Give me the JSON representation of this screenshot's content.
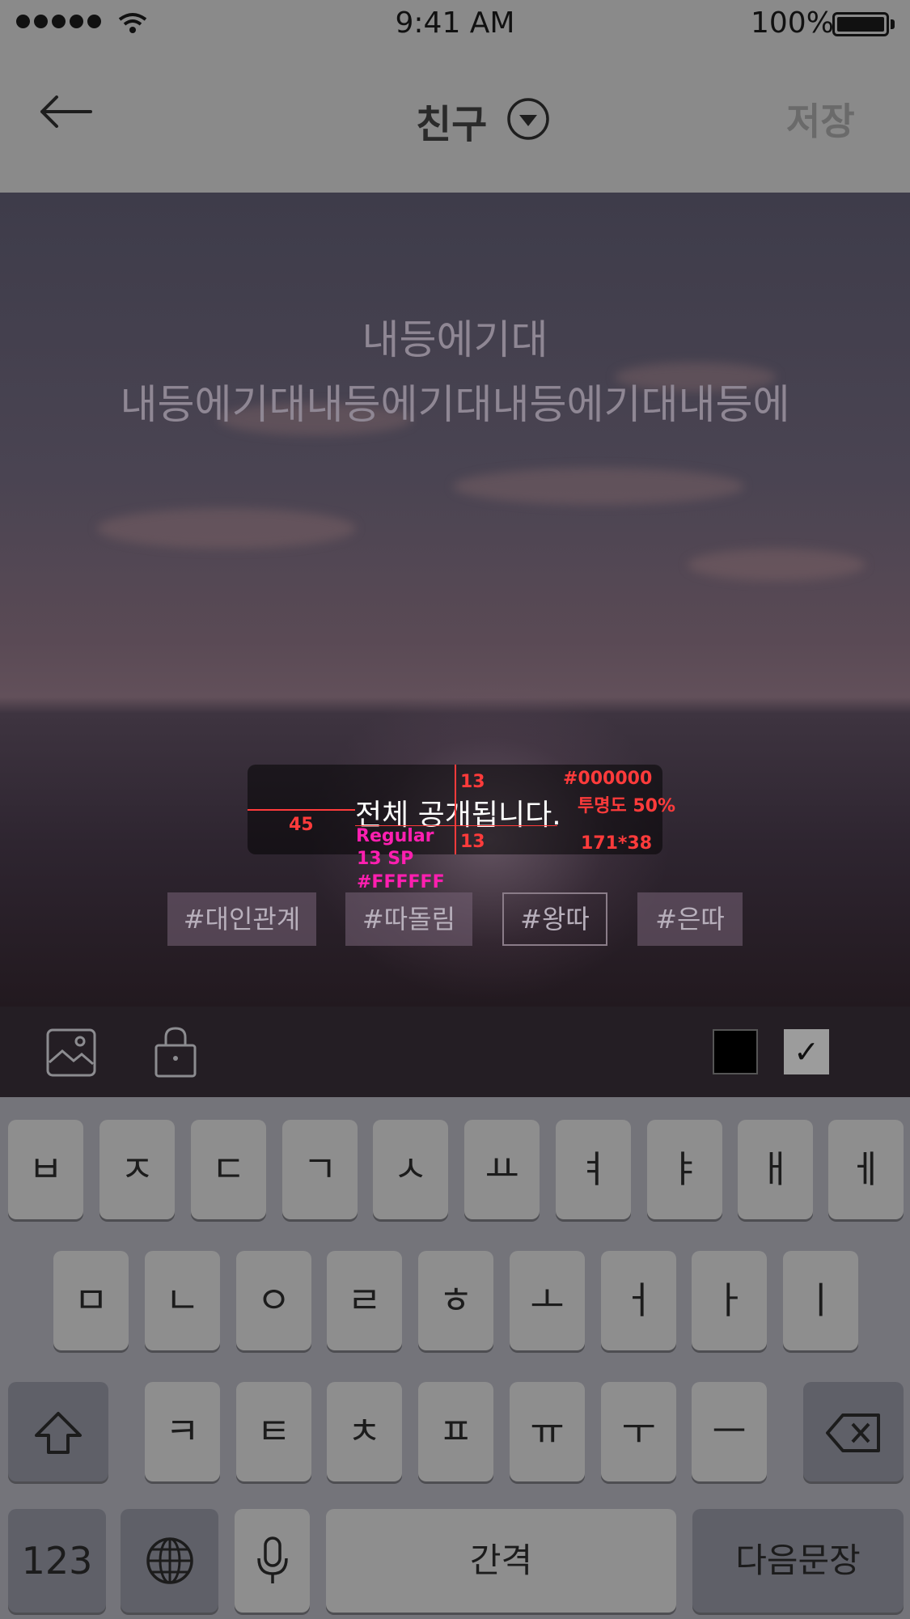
{
  "status_bar": {
    "time": "9:41 AM",
    "battery": "100%"
  },
  "header": {
    "title": "친구",
    "save_label": "저장"
  },
  "caption": {
    "line1": "내등에기대",
    "line2": "내등에기대내등에기대내등에기대내등에"
  },
  "toast": {
    "text": "전체 공개됩니다.",
    "annotations": {
      "padding_top": "13",
      "padding_bottom": "13",
      "padding_left": "45",
      "bg_color": "#000000",
      "opacity": "투명도 50%",
      "size": "171*38",
      "font_weight": "Regular",
      "font_size": "13 SP",
      "font_color": "#FFFFFF"
    }
  },
  "tags": [
    "#대인관계",
    "#따돌림",
    "#왕따",
    "#은따"
  ],
  "selected_tag": "#왕따",
  "toolbar": {
    "icons": [
      "image-icon",
      "lock-icon"
    ],
    "color_swatches": [
      "#000000",
      "check"
    ]
  },
  "keyboard": {
    "row1": [
      "ㅂ",
      "ㅈ",
      "ㄷ",
      "ㄱ",
      "ㅅ",
      "ㅛ",
      "ㅕ",
      "ㅑ",
      "ㅐ",
      "ㅔ"
    ],
    "row2": [
      "ㅁ",
      "ㄴ",
      "ㅇ",
      "ㄹ",
      "ㅎ",
      "ㅗ",
      "ㅓ",
      "ㅏ",
      "ㅣ"
    ],
    "row3": [
      "ㅋ",
      "ㅌ",
      "ㅊ",
      "ㅍ",
      "ㅠ",
      "ㅜ",
      "ㅡ"
    ],
    "numbers_label": "123",
    "space_label": "간격",
    "return_label": "다음문장"
  }
}
